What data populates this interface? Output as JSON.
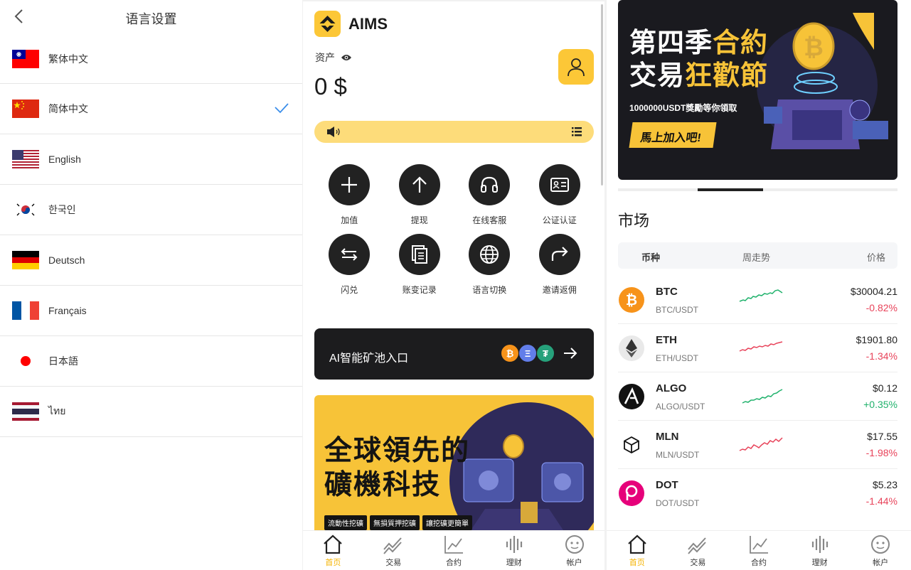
{
  "language_settings": {
    "title": "语言设置",
    "languages": [
      {
        "label": "繁体中文",
        "flag": "taiwan",
        "selected": false
      },
      {
        "label": "简体中文",
        "flag": "china",
        "selected": true
      },
      {
        "label": "English",
        "flag": "usa",
        "selected": false
      },
      {
        "label": "한국인",
        "flag": "korea",
        "selected": false
      },
      {
        "label": "Deutsch",
        "flag": "germany",
        "selected": false
      },
      {
        "label": "Français",
        "flag": "france",
        "selected": false
      },
      {
        "label": "日本語",
        "flag": "japan",
        "selected": false
      },
      {
        "label": "ไทย",
        "flag": "thailand",
        "selected": false
      }
    ]
  },
  "home": {
    "brand": "AIMS",
    "assets_label": "资产",
    "assets_value": "0 $",
    "actions": [
      {
        "label": "加值",
        "icon": "plus-icon"
      },
      {
        "label": "提现",
        "icon": "arrow-up-icon"
      },
      {
        "label": "在线客服",
        "icon": "headset-icon"
      },
      {
        "label": "公证认证",
        "icon": "id-card-icon"
      },
      {
        "label": "闪兑",
        "icon": "swap-icon"
      },
      {
        "label": "账变记录",
        "icon": "records-icon"
      },
      {
        "label": "语言切换",
        "icon": "globe-icon"
      },
      {
        "label": "邀请返佣",
        "icon": "share-icon"
      }
    ],
    "ai_banner": {
      "label": "AI智能矿池入口",
      "coins": [
        "₿",
        "Ξ",
        "₮"
      ]
    },
    "promo": {
      "title_line1": "全球領先的",
      "title_line2": "礦機科技",
      "tags": [
        "流動性挖礦",
        "無損質押挖礦",
        "讓挖礦更簡單"
      ]
    }
  },
  "tabbar": [
    {
      "label": "首页",
      "icon": "home-icon",
      "active": true
    },
    {
      "label": "交易",
      "icon": "trade-icon",
      "active": false
    },
    {
      "label": "合约",
      "icon": "contract-icon",
      "active": false
    },
    {
      "label": "理财",
      "icon": "finance-icon",
      "active": false
    },
    {
      "label": "帐户",
      "icon": "account-icon",
      "active": false
    }
  ],
  "market": {
    "promo": {
      "title_line1_a": "第四季",
      "title_line1_b": "合約",
      "title_line2_a": "交易",
      "title_line2_b": "狂歡節",
      "subtitle": "1000000USDT獎勵等你領取",
      "cta": "馬上加入吧!"
    },
    "title": "市场",
    "headers": {
      "coin": "币种",
      "trend": "周走势",
      "price": "价格"
    },
    "rows": [
      {
        "symbol": "BTC",
        "pair": "BTC/USDT",
        "price": "$30004.21",
        "change": "-0.82%",
        "direction": "down",
        "spark": "up",
        "icon_color": "#f7931a",
        "icon_glyph": "₿"
      },
      {
        "symbol": "ETH",
        "pair": "ETH/USDT",
        "price": "$1901.80",
        "change": "-1.34%",
        "direction": "down",
        "spark": "down",
        "icon_color": "#e9e9e9",
        "icon_glyph": "◆"
      },
      {
        "symbol": "ALGO",
        "pair": "ALGO/USDT",
        "price": "$0.12",
        "change": "+0.35%",
        "direction": "up",
        "spark": "up",
        "icon_color": "#111111",
        "icon_glyph": "A"
      },
      {
        "symbol": "MLN",
        "pair": "MLN/USDT",
        "price": "$17.55",
        "change": "-1.98%",
        "direction": "down",
        "spark": "down",
        "icon_color": "#ffffff",
        "icon_glyph": "⬡"
      },
      {
        "symbol": "DOT",
        "pair": "DOT/USDT",
        "price": "$5.23",
        "change": "-1.44%",
        "direction": "down",
        "spark": "down",
        "icon_color": "#e6007a",
        "icon_glyph": "P"
      }
    ]
  },
  "colors": {
    "accent": "#fcc737",
    "up": "#20b26c",
    "down": "#e8435a",
    "check": "#3b8eea"
  }
}
